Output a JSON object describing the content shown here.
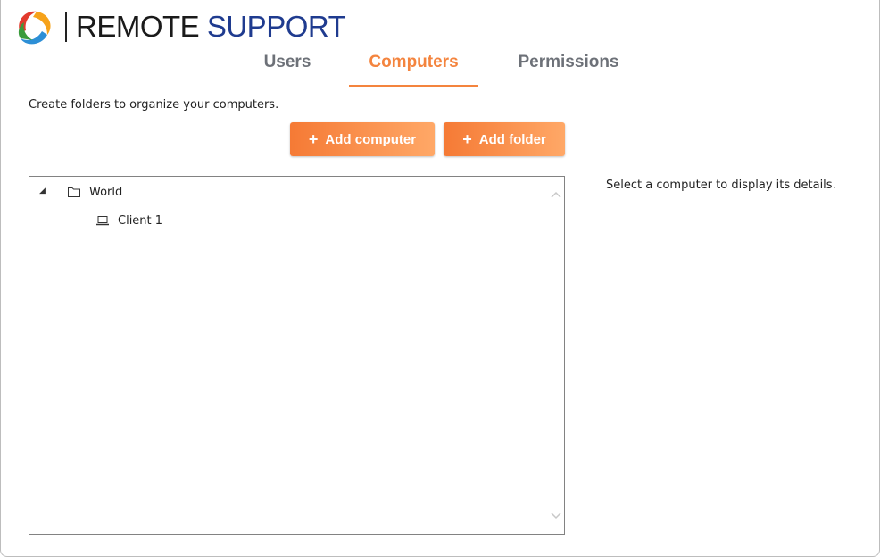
{
  "brand": {
    "word1": "REMOTE",
    "word2": "SUPPORT"
  },
  "tabs": [
    {
      "label": "Users",
      "active": false
    },
    {
      "label": "Computers",
      "active": true
    },
    {
      "label": "Permissions",
      "active": false
    }
  ],
  "intro_text": "Create folders to organize your computers.",
  "buttons": {
    "add_computer": "Add computer",
    "add_folder": "Add folder",
    "plus_glyph": "+"
  },
  "tree": {
    "expander_glyph": "◢",
    "items": [
      {
        "label": "World",
        "icon": "folder-icon",
        "expanded": true
      },
      {
        "label": "Client 1",
        "icon": "laptop-icon"
      }
    ]
  },
  "details_text": "Select a computer to display its details.",
  "colors": {
    "accent": "#f4843e",
    "brand_blue": "#1f3b8f",
    "tab_inactive": "#6d7178"
  }
}
